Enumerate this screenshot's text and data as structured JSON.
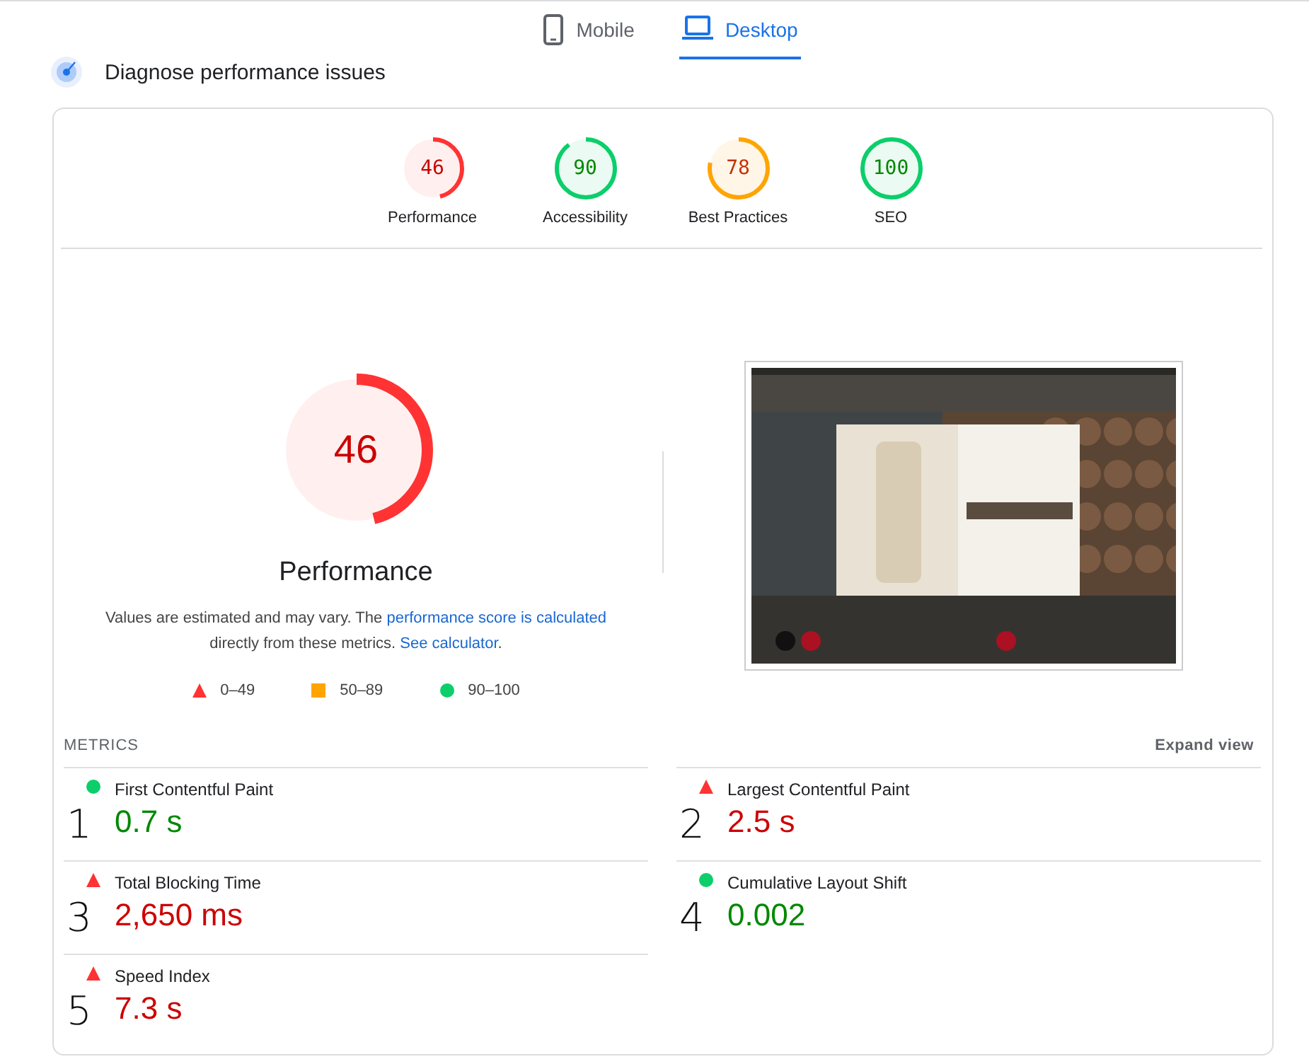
{
  "tabs": [
    {
      "label": "Mobile",
      "kind": "phone",
      "selected": false
    },
    {
      "label": "Desktop",
      "kind": "laptop",
      "selected": true
    }
  ],
  "heading": "Diagnose performance issues",
  "categories": [
    {
      "score": "46",
      "label": "Performance",
      "color": "#ff3333",
      "level": 0.46
    },
    {
      "score": "90",
      "label": "Accessibility",
      "color": "#0cce6b",
      "level": 0.9
    },
    {
      "score": "78",
      "label": "Best Practices",
      "color": "#ffa400",
      "level": 0.78
    },
    {
      "score": "100",
      "label": "SEO",
      "color": "#0cce6b",
      "level": 1
    }
  ],
  "performance": {
    "score": "46",
    "label": "Performance",
    "color": "#ff3333",
    "level": 0.46,
    "description": [
      {
        "kind": "text",
        "text": "Values are estimated and may vary. The "
      },
      {
        "kind": "link",
        "text": "performance score is calculated"
      },
      {
        "kind": "text",
        "text": " directly from these metrics. "
      },
      {
        "kind": "link",
        "text": "See calculator"
      },
      {
        "kind": "text",
        "text": "."
      }
    ]
  },
  "legend": [
    {
      "kind": "triangle",
      "label": "0–49"
    },
    {
      "kind": "square",
      "label": "50–89"
    },
    {
      "kind": "circle",
      "label": "90–100"
    }
  ],
  "metrics_title": "METRICS",
  "expand_label": "Expand view",
  "metrics": [
    {
      "name": "First Contentful Paint",
      "value": "0.7 s",
      "color": "#0cce6b",
      "annotation": "1"
    },
    {
      "name": "Largest Contentful Paint",
      "value": "2.5 s",
      "color": "#ff3333",
      "annotation": "2"
    },
    {
      "name": "Total Blocking Time",
      "value": "2,650 ms",
      "color": "#ff3333",
      "annotation": "3"
    },
    {
      "name": "Cumulative Layout Shift",
      "value": "0.002",
      "color": "#0cce6b",
      "annotation": "4"
    },
    {
      "name": "Speed Index",
      "value": "7.3 s",
      "color": "#ff3333",
      "annotation": "5"
    }
  ]
}
